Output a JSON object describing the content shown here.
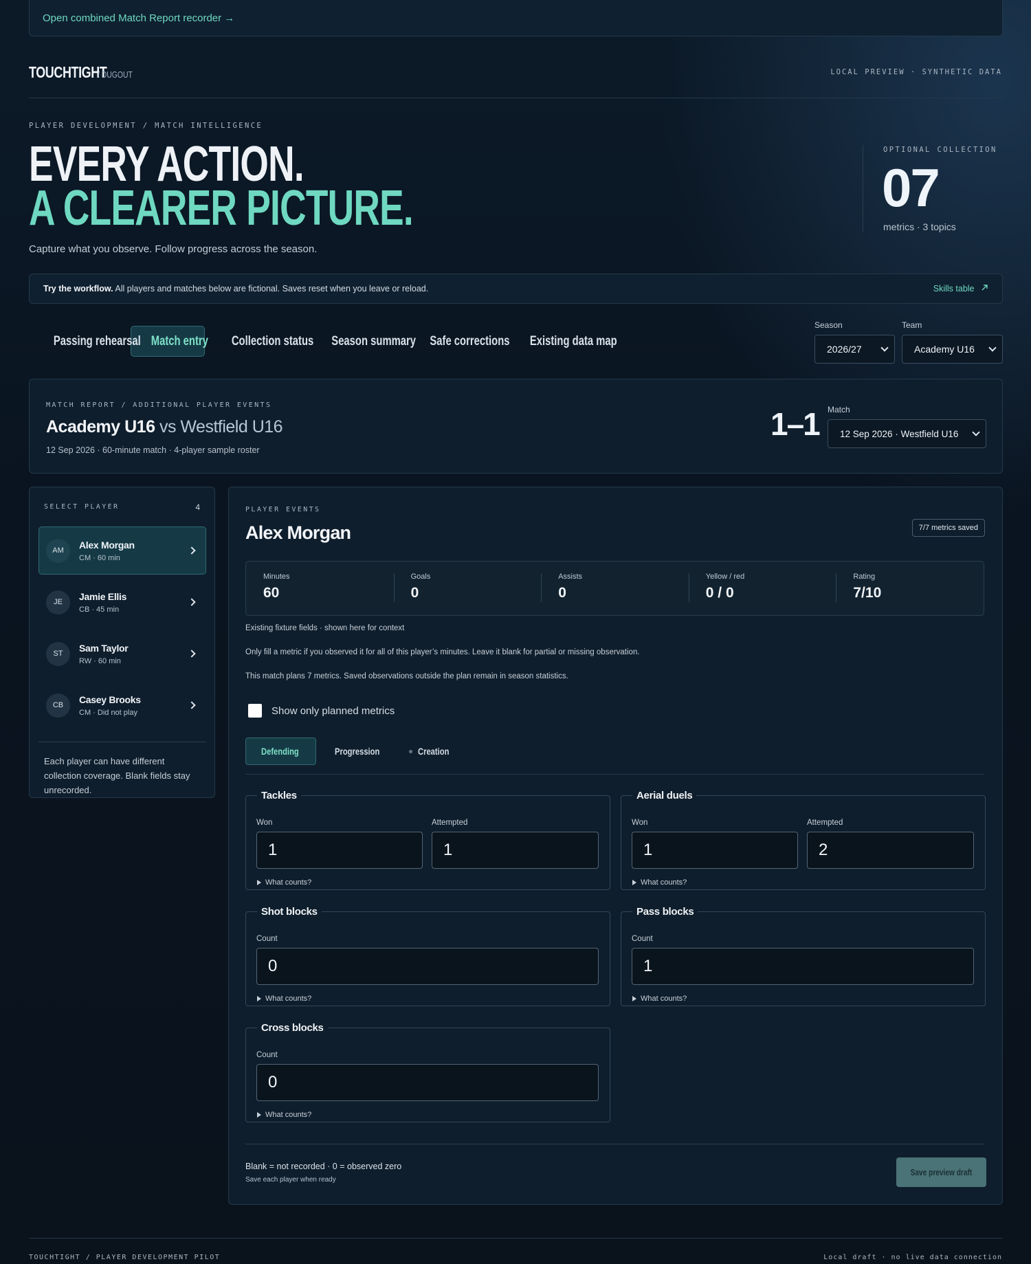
{
  "banner": {
    "link": "Open combined Match Report recorder →"
  },
  "brand": {
    "name": "TOUCHTIGHT",
    "suffix": "/ DUGOUT",
    "tag": "LOCAL PREVIEW · SYNTHETIC DATA"
  },
  "hero": {
    "eyebrow": "PLAYER DEVELOPMENT / MATCH INTELLIGENCE",
    "line1": "EVERY ACTION.",
    "line2": "A CLEARER PICTURE.",
    "subtitle": "Capture what you observe. Follow progress across the season.",
    "collection_label": "OPTIONAL COLLECTION",
    "collection_value": "07",
    "collection_meta": "metrics · 3 topics"
  },
  "notice": {
    "bold": "Try the workflow.",
    "text": " All players and matches below are fictional. Saves reset when you leave or reload.",
    "link": "Skills table"
  },
  "tabs": [
    "Passing rehearsal",
    "Match entry",
    "Collection status",
    "Season summary",
    "Safe corrections",
    "Existing data map"
  ],
  "filters": {
    "season_label": "Season",
    "season_value": "2026/27",
    "team_label": "Team",
    "team_value": "Academy U16"
  },
  "match": {
    "eyebrow": "MATCH REPORT / ADDITIONAL PLAYER EVENTS",
    "home": "Academy U16",
    "vs": "vs",
    "away": "Westfield U16",
    "meta": "12 Sep 2026 · 60-minute match · 4-player sample roster",
    "score": "1–1",
    "select_label": "Match",
    "select_value": "12 Sep 2026 · Westfield U16"
  },
  "players": {
    "label": "SELECT PLAYER",
    "count": "4",
    "items": [
      {
        "initials": "AM",
        "name": "Alex Morgan",
        "meta": "CM · 60 min"
      },
      {
        "initials": "JE",
        "name": "Jamie Ellis",
        "meta": "CB · 45 min"
      },
      {
        "initials": "ST",
        "name": "Sam Taylor",
        "meta": "RW · 60 min"
      },
      {
        "initials": "CB",
        "name": "Casey Brooks",
        "meta": "CM · Did not play"
      }
    ],
    "footnote": "Each player can have different collection coverage. Blank fields stay unrecorded."
  },
  "events": {
    "eyebrow": "PLAYER EVENTS",
    "player": "Alex Morgan",
    "saved": "7/7 metrics saved",
    "stats": [
      {
        "k": "Minutes",
        "v": "60"
      },
      {
        "k": "Goals",
        "v": "0"
      },
      {
        "k": "Assists",
        "v": "0"
      },
      {
        "k": "Yellow / red",
        "v": "0 / 0"
      },
      {
        "k": "Rating",
        "v": "7/10"
      }
    ],
    "note1": "Existing fixture fields · shown here for context",
    "note2": "Only fill a metric if you observed it for all of this player’s minutes. Leave it blank for partial or missing observation.",
    "note3": "This match plans 7 metrics. Saved observations outside the plan remain in season statistics.",
    "checkbox": "Show only planned metrics",
    "topics": [
      "Defending",
      "Progression",
      "Creation"
    ],
    "what_counts": "What counts?",
    "metrics": {
      "tackles": {
        "title": "Tackles",
        "won_label": "Won",
        "won": "1",
        "att_label": "Attempted",
        "att": "1"
      },
      "aerial": {
        "title": "Aerial duels",
        "won_label": "Won",
        "won": "1",
        "att_label": "Attempted",
        "att": "2"
      },
      "shot": {
        "title": "Shot blocks",
        "label": "Count",
        "value": "0"
      },
      "pass": {
        "title": "Pass blocks",
        "label": "Count",
        "value": "1"
      },
      "cross": {
        "title": "Cross blocks",
        "label": "Count",
        "value": "0"
      }
    },
    "legend": "Blank = not recorded · 0 = observed zero",
    "save_hint": "Save each player when ready",
    "save_button": "Save preview draft"
  },
  "footer": {
    "left": "TOUCHTIGHT / PLAYER DEVELOPMENT PILOT",
    "right": "Local draft · no live data connection"
  },
  "colors": {
    "accent": "#6fd8c1",
    "background": "#0a141d",
    "active_tab": "#153a46"
  }
}
